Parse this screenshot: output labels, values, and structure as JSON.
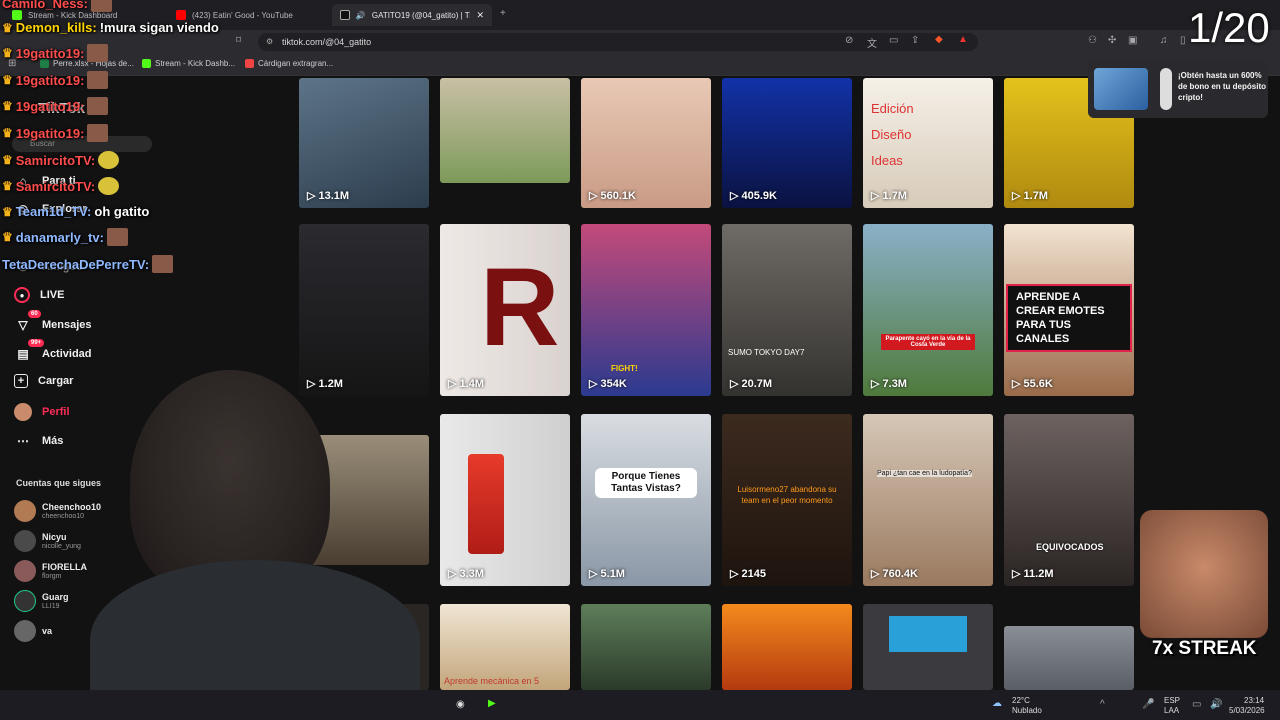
{
  "browser": {
    "tabs": [
      {
        "label": "Stream - Kick Dashboard"
      },
      {
        "label": "(423) Eatin' Good - YouTube"
      },
      {
        "label": "GATITO19 (@04_gatito) | TikT"
      }
    ],
    "url": "tiktok.com/@04_gatito",
    "bookmarks": [
      "Perre.xlsx - Hojas de...",
      "Stream - Kick Dashb...",
      "Cárdigan extragran..."
    ]
  },
  "tiktok": {
    "logo": "TikTok",
    "search_placeholder": "Buscar",
    "nav": [
      {
        "label": "Para ti",
        "icon": "home-icon"
      },
      {
        "label": "Explorar",
        "icon": "compass-icon"
      },
      {
        "label": "Amigos",
        "icon": "friends-icon"
      },
      {
        "label": "LIVE",
        "icon": "live-icon"
      },
      {
        "label": "Mensajes",
        "icon": "messages-icon",
        "badge": "60"
      },
      {
        "label": "Actividad",
        "icon": "activity-icon",
        "badge": "99+"
      },
      {
        "label": "Cargar",
        "icon": "plus-icon"
      },
      {
        "label": "Perfil",
        "icon": "profile-icon"
      },
      {
        "label": "Más",
        "icon": "more-icon"
      }
    ],
    "following_title": "Cuentas que sigues",
    "following": [
      {
        "name": "Cheenchoo10",
        "handle": "cheenchoo10"
      },
      {
        "name": "Nicyu",
        "handle": "nicolle_yung"
      },
      {
        "name": "FIORELLA",
        "handle": "florgm"
      },
      {
        "name": "Guarg",
        "handle": "LLI19"
      },
      {
        "name": "va",
        "handle": ""
      }
    ],
    "videos": [
      {
        "views": "13.1M",
        "caption": ""
      },
      {
        "views": "1M",
        "caption": ""
      },
      {
        "views": "560.1K",
        "caption": ""
      },
      {
        "views": "405.9K",
        "caption": ""
      },
      {
        "views": "1.7M",
        "caption": "Edición Diseño Ideas"
      },
      {
        "views": "1.7M",
        "caption": ""
      },
      {
        "views": "1.2M",
        "caption": ""
      },
      {
        "views": "1.4M",
        "caption": ""
      },
      {
        "views": "354K",
        "caption": "FIGHT!"
      },
      {
        "views": "20.7M",
        "caption": "SUMO TOKYO DAY7"
      },
      {
        "views": "7.3M",
        "caption": "Parapente cayó en la vía de la Costa Verde"
      },
      {
        "views": "55.6K",
        "caption": "APRENDE A CREAR EMOTES PARA TUS CANALES"
      },
      {
        "views": "",
        "caption": ""
      },
      {
        "views": "3.3M",
        "caption": ""
      },
      {
        "views": "5.1M",
        "caption": "Porque Tienes Tantas Vistas?"
      },
      {
        "views": "2145",
        "caption": "Luisormeno27 abandona su team en el peor momento"
      },
      {
        "views": "760.4K",
        "caption": "Papi ¿tan cae en la ludopatía?"
      },
      {
        "views": "11.2M",
        "caption": "EQUIVOCADOS"
      },
      {
        "views": "",
        "caption": ""
      },
      {
        "views": "",
        "caption": "Aprende mecánica en 5"
      },
      {
        "views": "",
        "caption": ""
      },
      {
        "views": "",
        "caption": ""
      },
      {
        "views": "",
        "caption": ""
      },
      {
        "views": "",
        "caption": ""
      }
    ],
    "promo": "¡Obtén hasta un 600% de bono en tu depósito cripto!"
  },
  "overlay": {
    "counter": "1/20",
    "streak": "7x STREAK",
    "chat": [
      {
        "user": "Camilo_Ness:",
        "msg": "",
        "color": "#ff4d4d"
      },
      {
        "user": "Demon_kills:",
        "msg": "!mura sigan viendo",
        "color": "#ffd400"
      },
      {
        "user": "19gatito19:",
        "msg": "",
        "color": "#ff4d4d"
      },
      {
        "user": "19gatito19:",
        "msg": "",
        "color": "#ff4d4d"
      },
      {
        "user": "19gatito19:",
        "msg": "",
        "color": "#ff4d4d"
      },
      {
        "user": "19gatito19:",
        "msg": "",
        "color": "#ff4d4d"
      },
      {
        "user": "SamircitoTV:",
        "msg": "",
        "color": "#ff4d4d"
      },
      {
        "user": "SamircitoTV:",
        "msg": "",
        "color": "#ff4d4d"
      },
      {
        "user": "Team1d_TV:",
        "msg": "oh gatito",
        "color": "#8fb8ff"
      },
      {
        "user": "danamarly_tv:",
        "msg": "",
        "color": "#8fb8ff"
      },
      {
        "user": "TetaDerechaDePerreTV:",
        "msg": "",
        "color": "#8fb8ff"
      }
    ]
  },
  "taskbar": {
    "temp": "22°C",
    "weather": "Nublado",
    "lang": "ESP",
    "lang2": "LAA",
    "time": "23:14",
    "date": "5/03/2026"
  }
}
